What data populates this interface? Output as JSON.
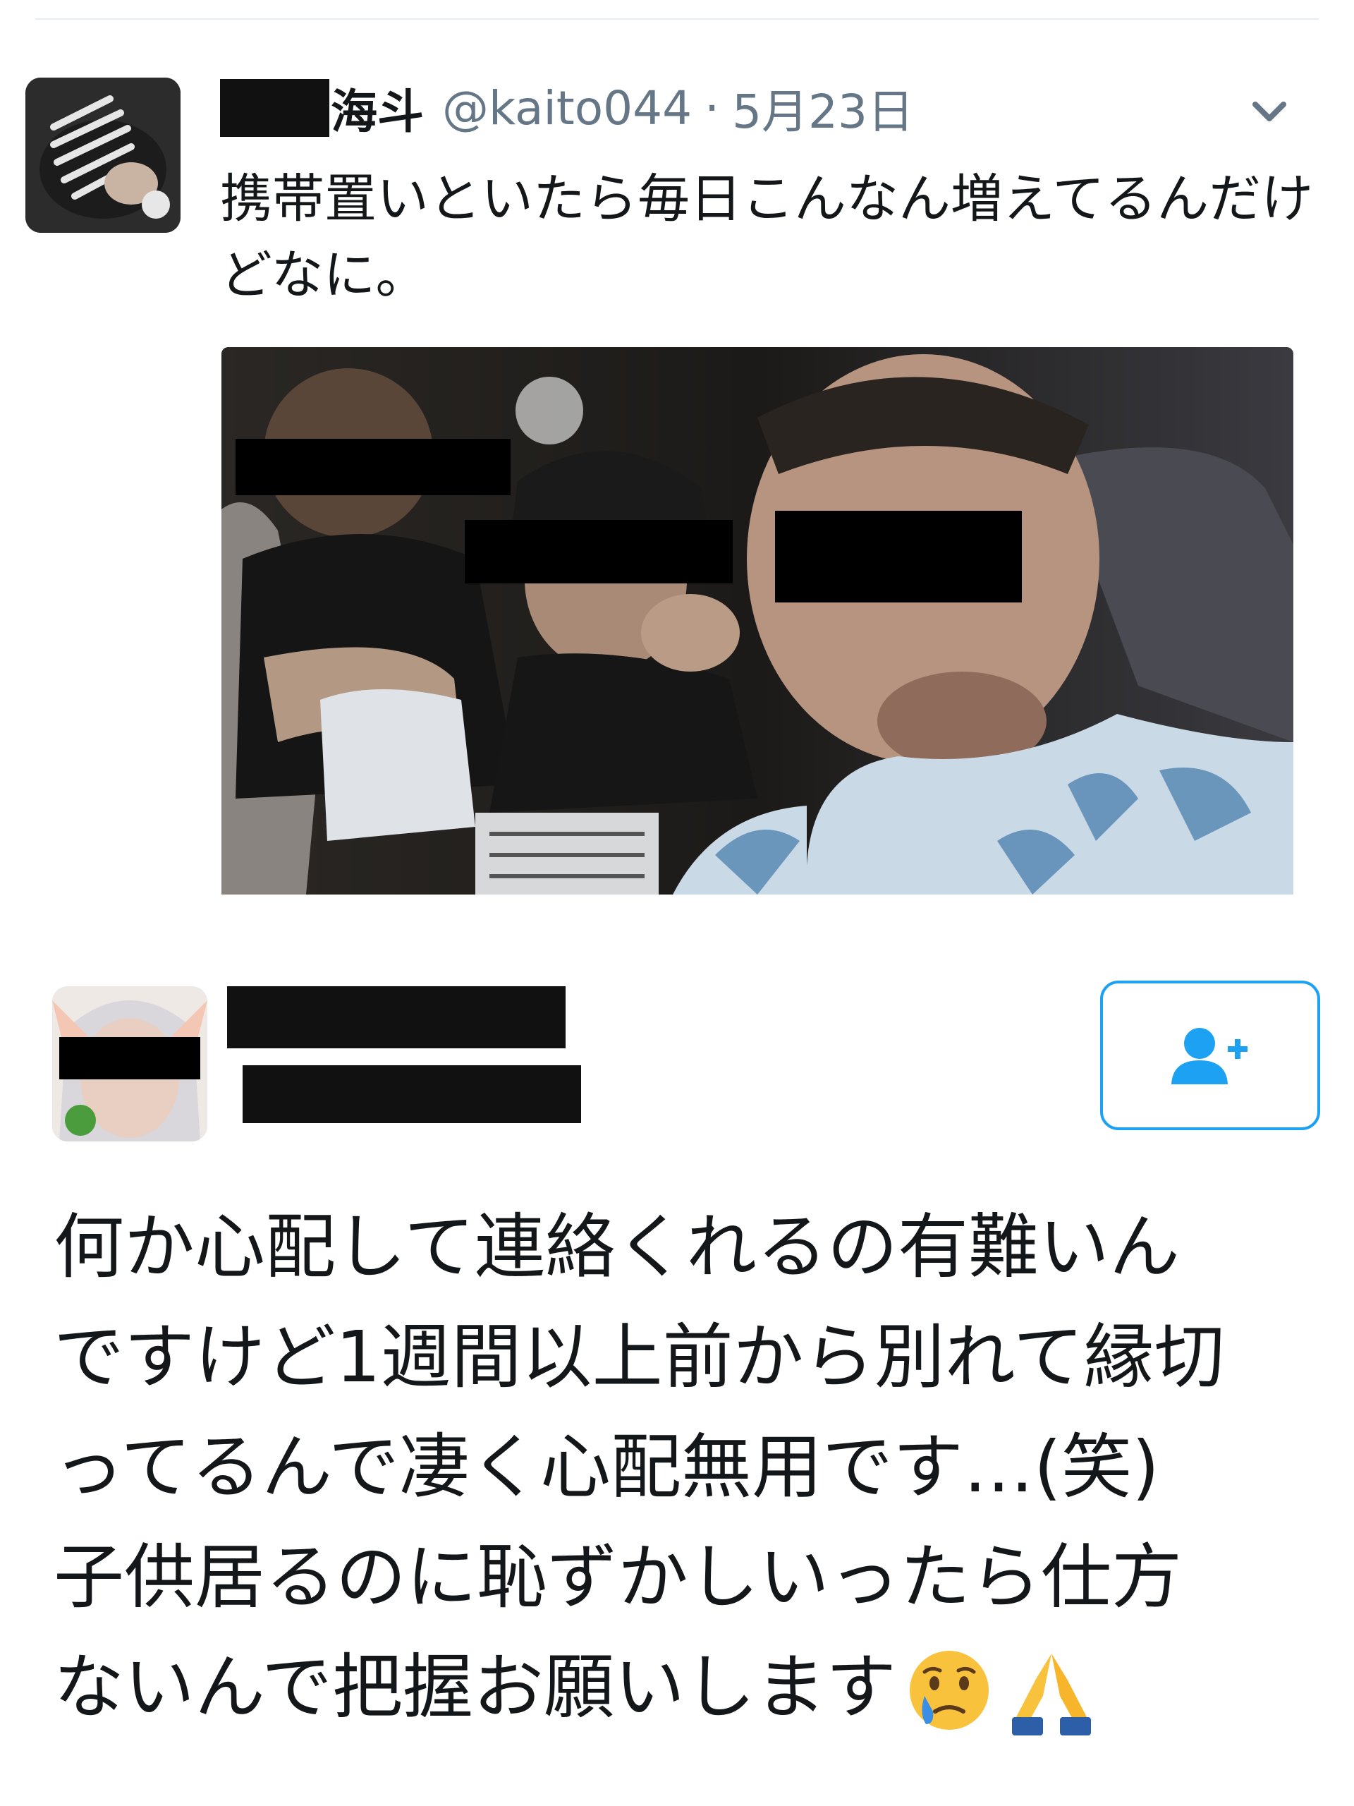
{
  "tweet1": {
    "display_name": "海斗",
    "handle": "@kaito044",
    "separator": "·",
    "date": "5月23日",
    "text": "携帯置いといたら毎日こんなん増えてるんだけどなに。"
  },
  "tweet2": {
    "text_lines": [
      "何か心配して連絡くれるの有難いん",
      "ですけど1週間以上前から別れて縁切",
      "ってるんで凄く心配無用です…(笑)",
      "子供居るのに恥ずかしいったら仕方",
      "ないんで把握お願いします"
    ]
  },
  "icons": {
    "caret": "chevron-down-icon",
    "follow": "add-user-icon",
    "emoji_1": "crying-face-emoji",
    "emoji_2": "folded-hands-emoji"
  },
  "colors": {
    "link_blue": "#1da1f2",
    "secondary_text": "#657786",
    "primary_text": "#14171a",
    "redaction": "#111111"
  }
}
